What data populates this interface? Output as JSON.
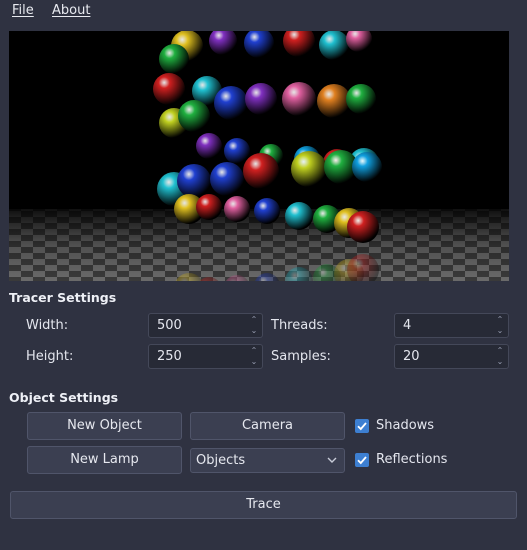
{
  "menu": {
    "file": "File",
    "about": "About"
  },
  "tracer": {
    "title": "Tracer Settings",
    "width_label": "Width:",
    "width_value": "500",
    "height_label": "Height:",
    "height_value": "250",
    "threads_label": "Threads:",
    "threads_value": "4",
    "samples_label": "Samples:",
    "samples_value": "20"
  },
  "object": {
    "title": "Object Settings",
    "new_object": "New Object",
    "camera": "Camera",
    "new_lamp": "New Lamp",
    "objects_select": "Objects",
    "shadows": "Shadows",
    "reflections": "Reflections"
  },
  "trace_button": "Trace",
  "colors": {
    "accent": "#3d7fd1",
    "background": "#2f3241"
  },
  "icons": {
    "spin_up": "chevron-up-icon",
    "spin_down": "chevron-down-icon",
    "check": "check-icon"
  }
}
